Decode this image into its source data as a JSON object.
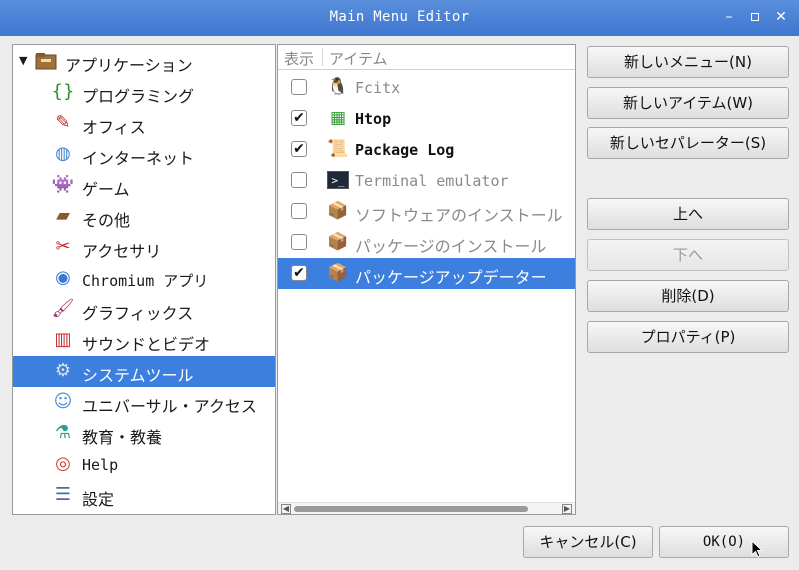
{
  "window": {
    "title": "Main Menu Editor",
    "minimize_glyph": "–",
    "maximize_glyph": "▫",
    "close_glyph": "✕"
  },
  "tree": {
    "root": {
      "label": "アプリケーション",
      "icon": "folder-icon",
      "expanded": true
    },
    "items": [
      {
        "label": "プログラミング",
        "icon": "programming-icon",
        "glyph": "{}",
        "color": "#2b8a2b"
      },
      {
        "label": "オフィス",
        "icon": "office-icon",
        "glyph": "✎",
        "color": "#c62828"
      },
      {
        "label": "インターネット",
        "icon": "globe-icon",
        "glyph": "◍",
        "color": "#3f7fd0"
      },
      {
        "label": "ゲーム",
        "icon": "game-invader-icon",
        "glyph": "👾",
        "color": "#2fa02f"
      },
      {
        "label": "その他",
        "icon": "box-icon",
        "glyph": "▰",
        "color": "#8b5a2b"
      },
      {
        "label": "アクセサリ",
        "icon": "swiss-knife-icon",
        "glyph": "✂",
        "color": "#c62828"
      },
      {
        "label": "Chromium アプリ",
        "icon": "chromium-icon",
        "glyph": "◉",
        "color": "#3a78d4"
      },
      {
        "label": "グラフィックス",
        "icon": "paintbrush-icon",
        "glyph": "🖌",
        "color": "#a0306a"
      },
      {
        "label": "サウンドとビデオ",
        "icon": "popcorn-icon",
        "glyph": "▥",
        "color": "#c62828"
      },
      {
        "label": "システムツール",
        "icon": "gear-icon",
        "glyph": "⚙",
        "color": "#e0e0e0",
        "selected": true
      },
      {
        "label": "ユニバーサル・アクセス",
        "icon": "user-icon",
        "glyph": "☺",
        "color": "#4a90d9"
      },
      {
        "label": "教育・教養",
        "icon": "flask-icon",
        "glyph": "⚗",
        "color": "#2e9e8e"
      },
      {
        "label": "Help",
        "icon": "lifebuoy-icon",
        "glyph": "◎",
        "color": "#d23c2a"
      },
      {
        "label": "設定",
        "icon": "settings-panel-icon",
        "glyph": "☰",
        "color": "#4d6b9a"
      }
    ]
  },
  "list": {
    "col_show": "表示",
    "col_item": "アイテム",
    "items": [
      {
        "label": "Fcitx",
        "checked": false,
        "style": "dim",
        "icon": "penguin-icon",
        "glyph": "🐧"
      },
      {
        "label": "Htop",
        "checked": true,
        "style": "bold",
        "icon": "htop-icon",
        "glyph": "▦"
      },
      {
        "label": "Package Log",
        "checked": true,
        "style": "bold",
        "icon": "log-icon",
        "glyph": "📜"
      },
      {
        "label": "Terminal emulator",
        "checked": false,
        "style": "dim",
        "icon": "terminal-icon",
        "glyph": ">_"
      },
      {
        "label": "ソフトウェアのインストール",
        "checked": false,
        "style": "dim",
        "icon": "package-install-icon",
        "glyph": "📦"
      },
      {
        "label": "パッケージのインストール",
        "checked": false,
        "style": "dim",
        "icon": "package-install-icon",
        "glyph": "📦"
      },
      {
        "label": "パッケージアップデーター",
        "checked": true,
        "style": "normal",
        "icon": "package-update-icon",
        "glyph": "📦",
        "selected": true
      }
    ],
    "check_glyph": "✔"
  },
  "buttons": {
    "new_menu": "新しいメニュー(N)",
    "new_item": "新しいアイテム(W)",
    "new_separator": "新しいセパレーター(S)",
    "move_up": "上へ",
    "move_down": "下へ",
    "delete": "削除(D)",
    "properties": "プロパティ(P)",
    "cancel": "キャンセル(C)",
    "ok": "OK(O)"
  }
}
